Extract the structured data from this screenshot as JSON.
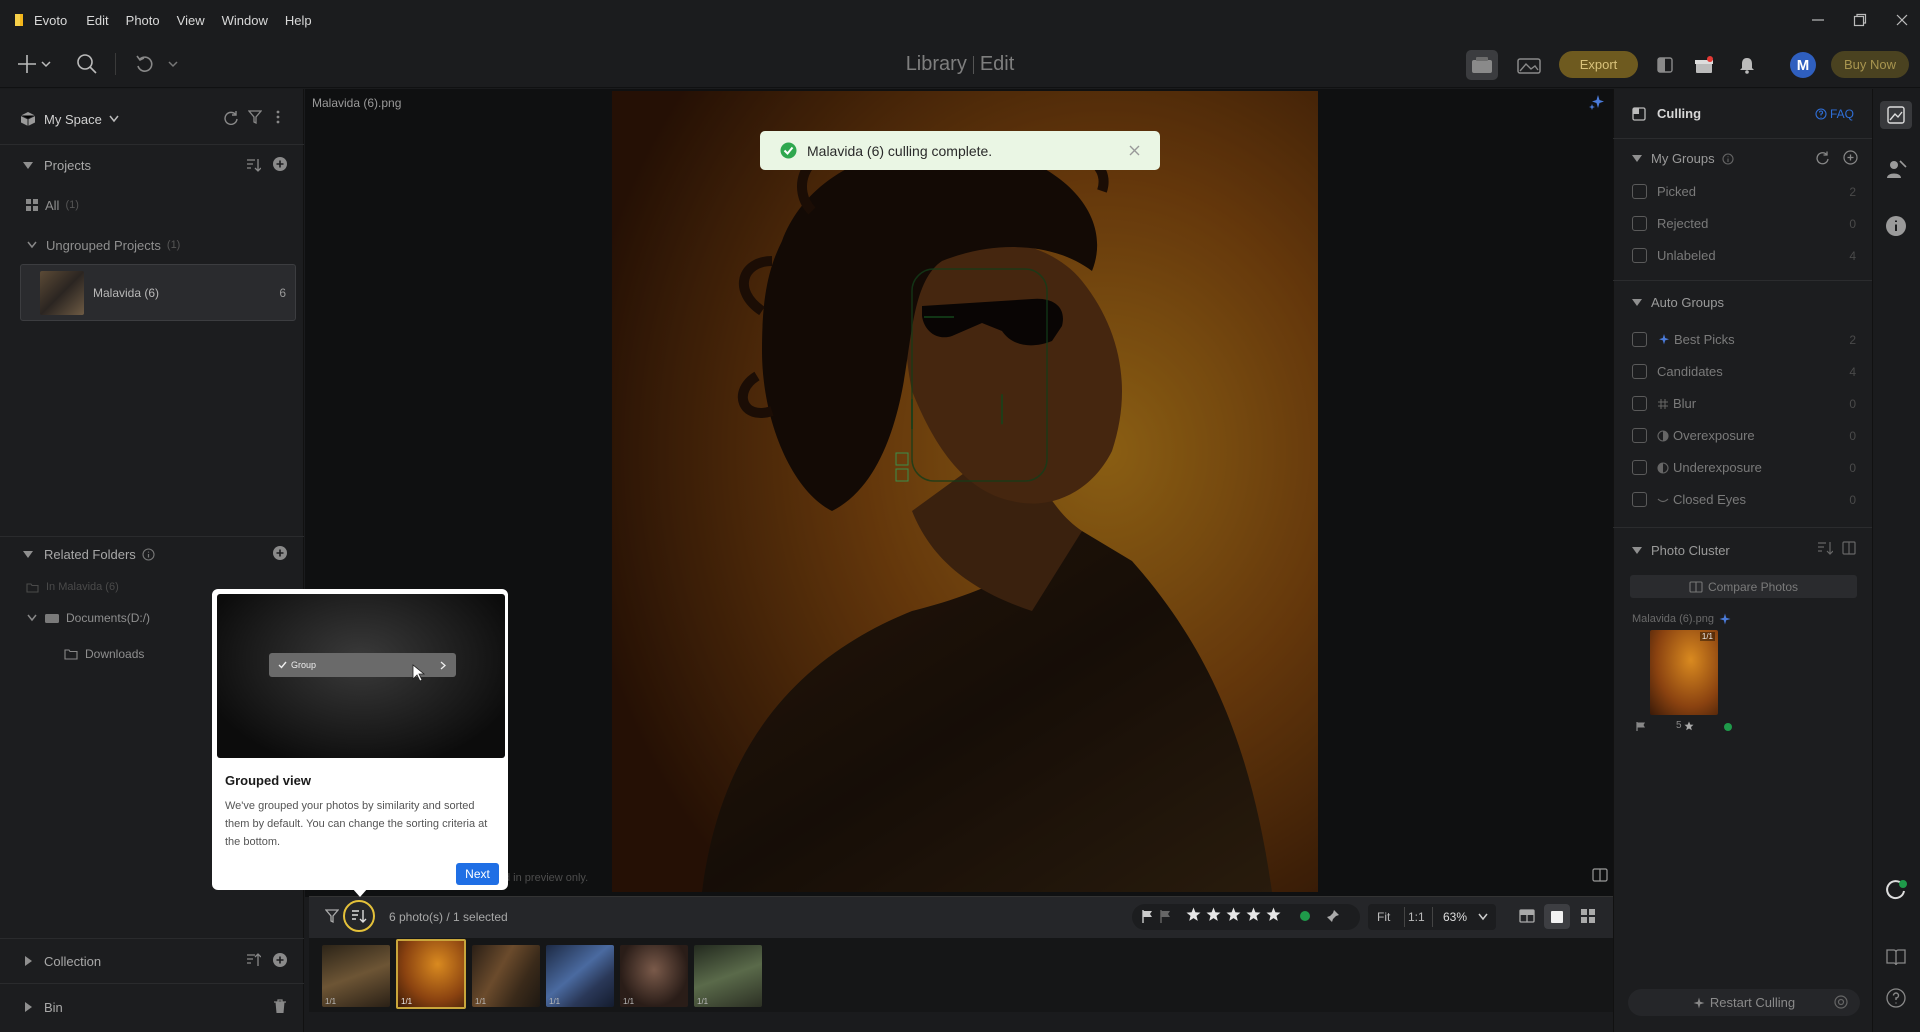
{
  "menu": {
    "app_name": "Evoto",
    "items": [
      "Edit",
      "Photo",
      "View",
      "Window",
      "Help"
    ]
  },
  "toolbar": {
    "mode_library": "Library",
    "mode_edit": "Edit",
    "export_label": "Export",
    "buy_label": "Buy Now",
    "avatar_initial": "M"
  },
  "left_panel": {
    "space_label": "My Space",
    "projects_label": "Projects",
    "all_label": "All",
    "all_count": "(1)",
    "ungrouped_label": "Ungrouped Projects",
    "ungrouped_count": "(1)",
    "project_name": "Malavida (6)",
    "project_count": "6",
    "related_label": "Related Folders",
    "in_project_label": "In Malavida (6)",
    "documents_label": "Documents(D:/)",
    "downloads_label": "Downloads",
    "collection_label": "Collection",
    "bin_label": "Bin"
  },
  "center": {
    "file_name": "Malavida (6).png",
    "toast_message": "Malavida (6) culling complete.",
    "preview_note": "d in preview only."
  },
  "popover": {
    "preview_item": "Group",
    "title": "Grouped view",
    "description": "We've grouped your photos by similarity and sorted them by default. You can change the sorting criteria at the bottom.",
    "next_label": "Next"
  },
  "bottom_bar": {
    "photo_count": "6 photo(s) / 1 selected",
    "fit_label": "Fit",
    "one_to_one_label": "1:1",
    "zoom_value": "63%"
  },
  "filmstrip": {
    "thumb_labels": [
      "1/1",
      "1/1",
      "1/1",
      "1/1",
      "1/1",
      "1/1"
    ]
  },
  "right_panel": {
    "section_title": "Culling",
    "faq_label": "FAQ",
    "my_groups_label": "My Groups",
    "my_groups": [
      {
        "label": "Picked",
        "count": "2"
      },
      {
        "label": "Rejected",
        "count": "0"
      },
      {
        "label": "Unlabeled",
        "count": "4"
      }
    ],
    "auto_groups_label": "Auto Groups",
    "auto_groups": [
      {
        "label": "Best Picks",
        "count": "2"
      },
      {
        "label": "Candidates",
        "count": "4"
      },
      {
        "label": "Blur",
        "count": "0"
      },
      {
        "label": "Overexposure",
        "count": "0"
      },
      {
        "label": "Underexposure",
        "count": "0"
      },
      {
        "label": "Closed Eyes",
        "count": "0"
      }
    ],
    "photo_cluster_label": "Photo Cluster",
    "compare_label": "Compare Photos",
    "cluster_file_name": "Malavida (6).png",
    "cluster_badge": "1/1",
    "cluster_rating": "5",
    "restart_label": "Restart Culling"
  },
  "colors": {
    "accent_gold": "#6e5a1f",
    "toast_bg": "#eaf6e4",
    "toast_icon": "#2fa84f",
    "next_button": "#1f6fe5",
    "avatar": "#2f5fbf"
  }
}
